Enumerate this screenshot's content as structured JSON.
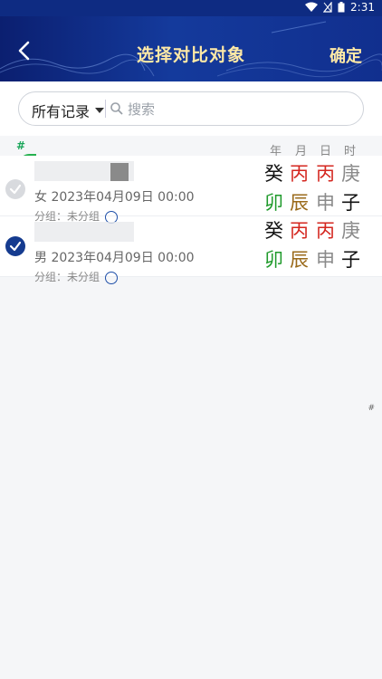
{
  "status_bar": {
    "time": "2:31"
  },
  "header": {
    "title": "选择对比对象",
    "confirm_label": "确定"
  },
  "search": {
    "filter_label": "所有记录",
    "placeholder": "搜索"
  },
  "list_header": {
    "index_label": "#",
    "columns": [
      "年",
      "月",
      "日",
      "时"
    ]
  },
  "rows": [
    {
      "selected": false,
      "date_text": "女 2023年04月09日 00:00",
      "group_text": "分组：未分组",
      "stems": [
        {
          "char": "癸",
          "color": "#111111"
        },
        {
          "char": "丙",
          "color": "#d4261f"
        },
        {
          "char": "丙",
          "color": "#d4261f"
        },
        {
          "char": "庚",
          "color": "#8a8a8a"
        }
      ],
      "branches": [
        {
          "char": "卯",
          "color": "#1f9a2b"
        },
        {
          "char": "辰",
          "color": "#9a6a1a"
        },
        {
          "char": "申",
          "color": "#8a8a8a"
        },
        {
          "char": "子",
          "color": "#111111"
        }
      ]
    },
    {
      "selected": true,
      "date_text": "男 2023年04月09日 00:00",
      "group_text": "分组：未分组",
      "stems": [
        {
          "char": "癸",
          "color": "#111111"
        },
        {
          "char": "丙",
          "color": "#d4261f"
        },
        {
          "char": "丙",
          "color": "#d4261f"
        },
        {
          "char": "庚",
          "color": "#8a8a8a"
        }
      ],
      "branches": [
        {
          "char": "卯",
          "color": "#1f9a2b"
        },
        {
          "char": "辰",
          "color": "#9a6a1a"
        },
        {
          "char": "申",
          "color": "#8a8a8a"
        },
        {
          "char": "子",
          "color": "#111111"
        }
      ]
    }
  ],
  "side_hash": "#"
}
